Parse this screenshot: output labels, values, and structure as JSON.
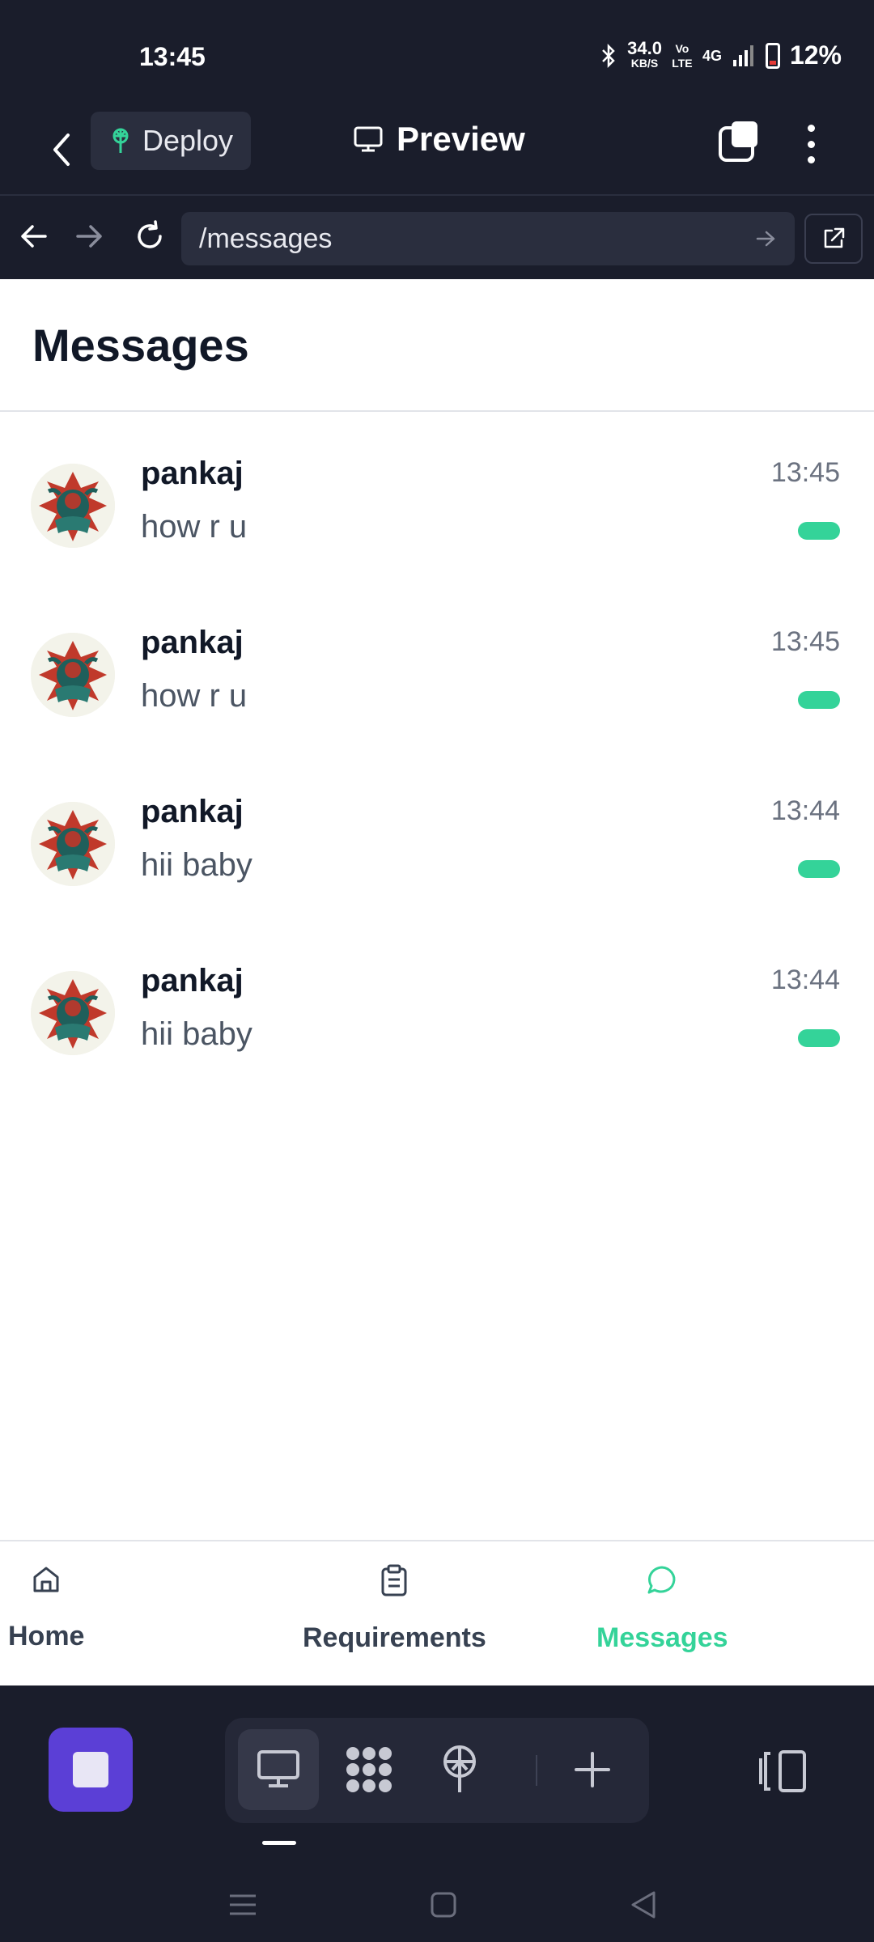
{
  "status_bar": {
    "time": "13:45",
    "network_speed_value": "34.0",
    "network_speed_unit": "KB/S",
    "volte": "Vo LTE",
    "network_type": "4G",
    "battery": "12%"
  },
  "header": {
    "deploy_label": "Deploy",
    "title": "Preview"
  },
  "browser": {
    "url": "/messages"
  },
  "page": {
    "heading": "Messages",
    "messages": [
      {
        "name": "pankaj",
        "text": "how r u",
        "time": "13:45"
      },
      {
        "name": "pankaj",
        "text": "how r u",
        "time": "13:45"
      },
      {
        "name": "pankaj",
        "text": "hii baby",
        "time": "13:44"
      },
      {
        "name": "pankaj",
        "text": "hii baby",
        "time": "13:44"
      }
    ],
    "bottom_nav": [
      {
        "label": "Home",
        "icon": "home-icon"
      },
      {
        "label": "Requirements",
        "icon": "clipboard-icon"
      },
      {
        "label": "Messages",
        "icon": "chat-bubble-icon",
        "active": true
      }
    ]
  },
  "colors": {
    "accent": "#34d399",
    "dark_bg": "#1a1d2b",
    "stop_button": "#5b3fd6"
  }
}
